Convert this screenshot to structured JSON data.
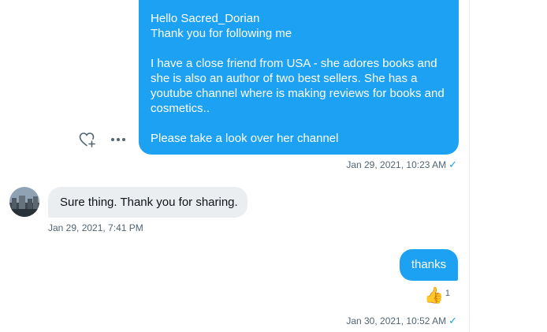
{
  "conversation": {
    "message_1": {
      "lines": [
        "Hello Sacred_Dorian",
        "Thank you for following me",
        "",
        "I have a close friend from USA - she adores books and",
        "she is also an author of two best sellers. She has a",
        "youtube channel where is making reviews for books and",
        "cosmetics..",
        "",
        "Please take a look over  her channel"
      ],
      "timestamp": "Jan 29, 2021, 10:23 AM",
      "status_icon": "sent-check"
    },
    "message_2": {
      "text": "Sure thing. Thank you for sharing.",
      "timestamp": "Jan 29, 2021, 7:41 PM"
    },
    "message_3": {
      "text": "thanks",
      "reaction_emoji": "👍",
      "reaction_count": "1",
      "timestamp": "Jan 30, 2021, 10:52 AM",
      "status_icon": "sent-check"
    }
  },
  "actions": {
    "react_icon": "heart-plus-icon",
    "more_icon": "more-horizontal-icon"
  },
  "colors": {
    "accent": "#1da1f2",
    "incoming_bubble": "#ebeef0",
    "meta_text": "#536471"
  }
}
